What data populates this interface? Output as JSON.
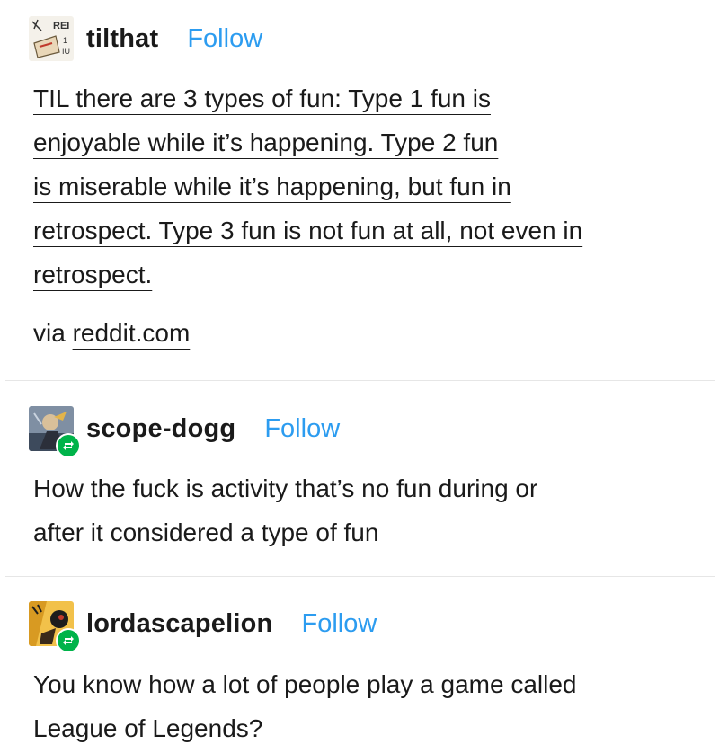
{
  "posts": [
    {
      "username": "tilthat",
      "follow_label": "Follow",
      "avatar_icon": "til-logo-avatar",
      "body_lines": [
        "TIL there are 3 types of fun: Type 1 fun is",
        "enjoyable while it’s happening. Type 2 fun",
        "is miserable while it’s happening, but fun in",
        "retrospect. Type 3 fun is not fun at all, not even in",
        "retrospect."
      ],
      "via_prefix": "via",
      "via_link": "reddit.com"
    },
    {
      "username": "scope-dogg",
      "follow_label": "Follow",
      "avatar_icon": "character-avatar",
      "reblog_icon": "reblog-icon",
      "body_lines": [
        "How the fuck is activity that’s no fun during or",
        "after it considered a type of fun"
      ]
    },
    {
      "username": "lordascapelion",
      "follow_label": "Follow",
      "avatar_icon": "anime-avatar",
      "reblog_icon": "reblog-icon",
      "body_lines": [
        "You know how a lot of people play a game called",
        "League of Legends?"
      ]
    }
  ],
  "colors": {
    "follow": "#2c9cf0",
    "reblog_badge": "#00b34a",
    "divider": "#e6e6e6"
  }
}
